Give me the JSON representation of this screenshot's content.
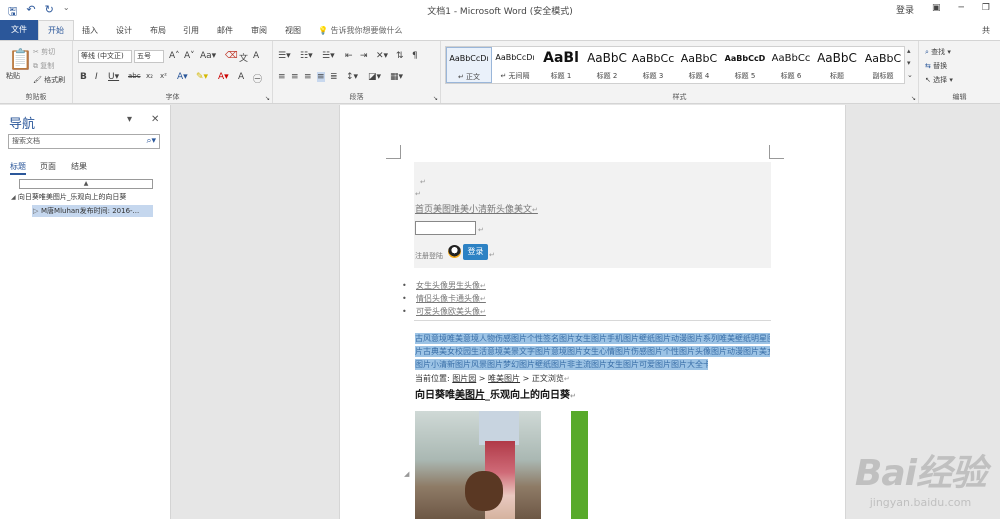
{
  "titlebar": {
    "title": "文档1 - Microsoft Word (安全模式)",
    "login": "登录"
  },
  "tabs": [
    {
      "label": "文件"
    },
    {
      "label": "开始"
    },
    {
      "label": "插入"
    },
    {
      "label": "设计"
    },
    {
      "label": "布局"
    },
    {
      "label": "引用"
    },
    {
      "label": "邮件"
    },
    {
      "label": "审阅"
    },
    {
      "label": "视图"
    }
  ],
  "tellme": "告诉我你想要做什么",
  "share": "共",
  "ribbon": {
    "clipboard": {
      "label": "剪贴板",
      "paste": "粘贴",
      "cut": "剪切",
      "copy": "复制",
      "format_painter": "格式刷"
    },
    "font": {
      "label": "字体",
      "font_name": "等线 (中文正)",
      "font_size": "五号"
    },
    "paragraph": {
      "label": "段落"
    },
    "styles": {
      "label": "样式",
      "items": [
        {
          "sample": "AaBbCcDı",
          "name": "↵ 正文"
        },
        {
          "sample": "AaBbCcDı",
          "name": "↵ 无间隔"
        },
        {
          "sample": "AaBl",
          "name": "标题 1"
        },
        {
          "sample": "AaBbC",
          "name": "标题 2"
        },
        {
          "sample": "AaBbCc",
          "name": "标题 3"
        },
        {
          "sample": "AaBbC",
          "name": "标题 4"
        },
        {
          "sample": "AaBbCcD",
          "name": "标题 5"
        },
        {
          "sample": "AaBbCc",
          "name": "标题 6"
        },
        {
          "sample": "AaBbC",
          "name": "标题"
        },
        {
          "sample": "AaBbC",
          "name": "副标题"
        }
      ]
    },
    "editing": {
      "label": "编辑",
      "find": "查找",
      "replace": "替换",
      "select": "选择"
    }
  },
  "nav": {
    "title": "导航",
    "search_placeholder": "搜索文档",
    "tabs": [
      {
        "label": "标题"
      },
      {
        "label": "页面"
      },
      {
        "label": "结果"
      }
    ],
    "tree_top": "向日葵唯美图片_乐观向上的向日葵",
    "tree_child": "M唐Mluhan发布时间: 2016-..."
  },
  "doc": {
    "top_link": "首页美图唯美小清新头像美文",
    "register": "注册登陆",
    "login_btn": "登录",
    "bullets": [
      "女生头像男生头像",
      "情侣头像卡通头像",
      "可爱头像欧美头像"
    ],
    "selected_lines": [
      "古风意境唯美意境人物伤感图片个性签名图片女生图片手机图片壁纸图片动漫图片系列唯美壁纸明星图",
      "片古典美女校园生活意境美景文字图片意境图片女生心情图片伤感图片个性图片头像图片动漫图片美女",
      "图片小清新图片风景图片梦幻图片壁纸图片非主流图片女生图片可爱图片图片大全卡通图片图"
    ],
    "crumb_prefix": "当前位置:",
    "crumb_link1": "图片园",
    "crumb_sep1": ">",
    "crumb_link2": "唯美图片",
    "crumb_sep2": "> 正文浏览",
    "heading_pre": "向日葵唯",
    "heading_link": "美图片",
    "heading_post": "_乐观向上的向日葵"
  },
  "watermark": {
    "brand": "Bai经验",
    "url": "jingyan.baidu.com"
  }
}
